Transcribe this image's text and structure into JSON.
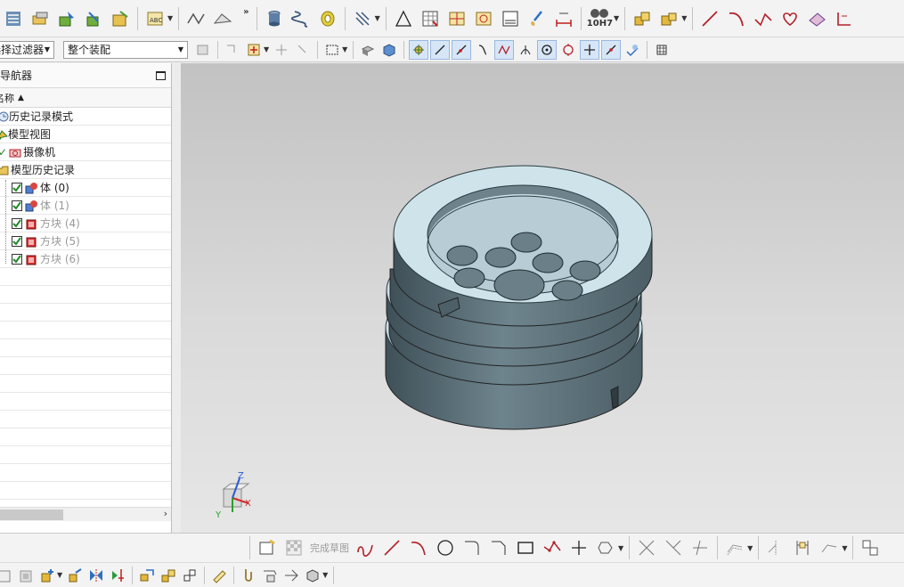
{
  "toolbar_top": {
    "overflow_glyph": "»",
    "tolerance_label": "10H7",
    "icons": [
      "assembly-navigator-icon",
      "part-icon",
      "add-component-icon",
      "assembly-constraint-icon",
      "move-component-icon",
      "text-note-icon",
      "sketch-curve-icon",
      "surface-icon",
      "cylinder-icon",
      "spring-icon",
      "tape-icon",
      "thread-icon",
      "triangle-icon",
      "table-icon",
      "view-layout-icon",
      "drawing-icon",
      "sheet-icon",
      "brush-icon",
      "dimension-icon",
      "assemble-icon",
      "component-box-icon",
      "line-icon",
      "arc-icon",
      "polyline-icon",
      "heart-shape-icon",
      "surface-patch-icon",
      "coordinate-icon"
    ]
  },
  "toolbar_second": {
    "filter_value": "选择过滤器",
    "scope_value": "整个装配",
    "icons": [
      "selection-settings-icon",
      "snap-icon",
      "rect-select-icon",
      "lasso-icon",
      "box-select-icon",
      "view-cube-icon",
      "shaded-icon",
      "point-snap-icon",
      "line-snap-icon",
      "endpoint-icon",
      "curve-snap-icon",
      "tangent-icon",
      "midpoint-icon",
      "center-icon",
      "quadrant-icon",
      "intersection-icon",
      "existing-point-icon",
      "bounded-icon",
      "grid-icon"
    ]
  },
  "navigator": {
    "title": "部件导航器",
    "column_name": "名称",
    "sort_glyph": "▲",
    "scroll_arrow": "›",
    "rows": [
      {
        "label": "历史记录模式",
        "dim": false
      },
      {
        "label": "模型视图",
        "dim": false
      },
      {
        "label": "摄像机",
        "dim": false
      },
      {
        "label": "模型历史记录",
        "dim": false
      },
      {
        "label": "体 (0)",
        "dim": false
      },
      {
        "label": "体 (1)",
        "dim": true
      },
      {
        "label": "方块 (4)",
        "dim": true
      },
      {
        "label": "方块 (5)",
        "dim": true
      },
      {
        "label": "方块 (6)",
        "dim": true
      }
    ]
  },
  "viewport": {
    "triad_labels": {
      "x": "X",
      "y": "Y",
      "z": "Z"
    },
    "colors": {
      "part_face": "#cfe3ea",
      "part_side": "#5c7079",
      "part_dark": "#3f4f57",
      "hole": "#6a7f88"
    }
  },
  "toolbar_sketch": {
    "finish_sketch_label": "完成草图",
    "icons": [
      "sketch-icon",
      "finish-sketch-icon",
      "profile-icon",
      "line-icon",
      "arc-icon",
      "circle-icon",
      "fillet-icon",
      "chamfer-icon",
      "rectangle-icon",
      "studio-spline-icon",
      "point-icon",
      "polygon-icon",
      "trim-icon",
      "extend-icon",
      "corner-icon",
      "offset-icon",
      "mirror-icon",
      "dimension-icon",
      "constraint-icon",
      "show-constraints-icon"
    ]
  },
  "toolbar_bottom": {
    "icons": [
      "feature-icon",
      "new-icon",
      "add-icon",
      "pattern-icon",
      "mirror-body-icon",
      "replace-icon",
      "wave-link-icon",
      "assembly-icon",
      "move-icon",
      "measure-icon",
      "clip-icon",
      "explode-icon",
      "sequence-icon",
      "cube-icon"
    ]
  }
}
